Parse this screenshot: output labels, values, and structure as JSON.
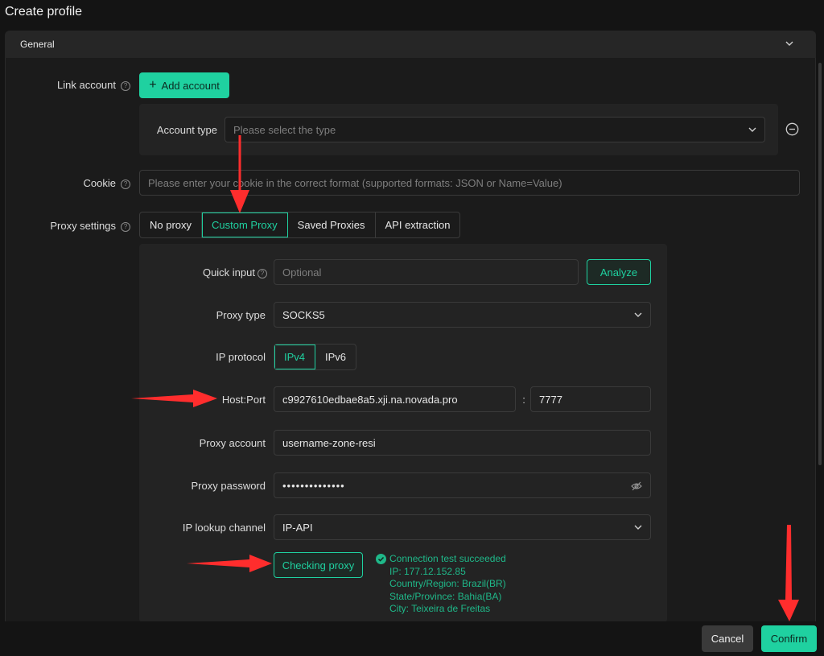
{
  "dialog": {
    "title": "Create profile"
  },
  "general": {
    "label": "General"
  },
  "link_account": {
    "label": "Link account",
    "add_button": "Add account"
  },
  "account_type": {
    "label": "Account type",
    "placeholder": "Please select the type"
  },
  "cookie": {
    "label": "Cookie",
    "placeholder": "Please enter your cookie in the correct format (supported formats: JSON or Name=Value)"
  },
  "proxy_settings": {
    "label": "Proxy settings",
    "tabs": [
      "No proxy",
      "Custom Proxy",
      "Saved Proxies",
      "API extraction"
    ],
    "active_tab": "Custom Proxy"
  },
  "quick_input": {
    "label": "Quick input",
    "placeholder": "Optional",
    "analyze": "Analyze"
  },
  "proxy_type": {
    "label": "Proxy type",
    "value": "SOCKS5"
  },
  "ip_protocol": {
    "label": "IP protocol",
    "options": [
      "IPv4",
      "IPv6"
    ],
    "active": "IPv4"
  },
  "host_port": {
    "label": "Host:Port",
    "host": "c9927610edbae8a5.xji.na.novada.pro",
    "separator": ":",
    "port": "7777"
  },
  "proxy_account": {
    "label": "Proxy account",
    "value": "username-zone-resi"
  },
  "proxy_password": {
    "label": "Proxy password",
    "value": "••••••••••••••"
  },
  "ip_lookup": {
    "label": "IP lookup channel",
    "value": "IP-API"
  },
  "check": {
    "button": "Checking proxy",
    "result": "Connection test succeeded",
    "ip": "IP: 177.12.152.85",
    "country": "Country/Region: Brazil(BR)",
    "state": "State/Province: Bahia(BA)",
    "city": "City: Teixeira de Freitas"
  },
  "footer": {
    "cancel": "Cancel",
    "confirm": "Confirm"
  },
  "colors": {
    "accent": "#1fd1a0",
    "arrow": "#ff2d2d",
    "background": "#141414"
  }
}
